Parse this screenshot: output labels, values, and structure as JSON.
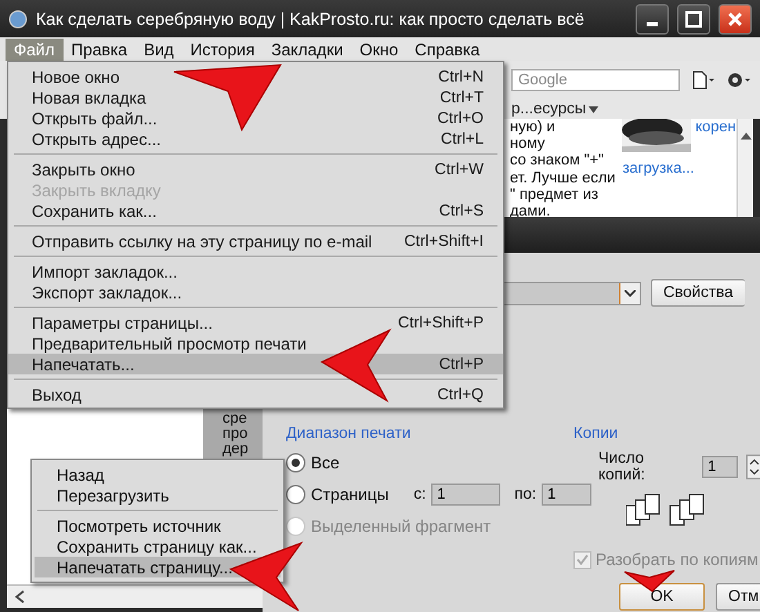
{
  "window": {
    "title": "Как сделать серебряную воду | KakProsto.ru: как просто сделать всё"
  },
  "menubar": [
    {
      "label": "Файл",
      "selected": true
    },
    {
      "label": "Правка",
      "selected": false
    },
    {
      "label": "Вид",
      "selected": false
    },
    {
      "label": "История",
      "selected": false
    },
    {
      "label": "Закладки",
      "selected": false
    },
    {
      "label": "Окно",
      "selected": false
    },
    {
      "label": "Справка",
      "selected": false
    }
  ],
  "toolbar": {
    "search": {
      "placeholder": "Google"
    },
    "bookmark": "р...есурсы"
  },
  "article": {
    "lines": [
      "ную) и",
      "ному",
      "со знаком \"+\"",
      "ет. Лучше если",
      "\" предмет из",
      "дами."
    ],
    "links": [
      "корен",
      "загрузка..."
    ]
  },
  "sidebar_fragments": [
    "сре",
    "про",
    "дер"
  ],
  "file_menu": [
    {
      "kind": "item",
      "label": "Новое окно",
      "shortcut": "Ctrl+N",
      "disabled": false,
      "highlighted": false
    },
    {
      "kind": "item",
      "label": "Новая вкладка",
      "shortcut": "Ctrl+T",
      "disabled": false,
      "highlighted": false
    },
    {
      "kind": "item",
      "label": "Открыть файл...",
      "shortcut": "Ctrl+O",
      "disabled": false,
      "highlighted": false
    },
    {
      "kind": "item",
      "label": "Открыть адрес...",
      "shortcut": "Ctrl+L",
      "disabled": false,
      "highlighted": false
    },
    {
      "kind": "separator"
    },
    {
      "kind": "item",
      "label": "Закрыть окно",
      "shortcut": "Ctrl+W",
      "disabled": false,
      "highlighted": false
    },
    {
      "kind": "item",
      "label": "Закрыть вкладку",
      "disabled": true,
      "highlighted": false
    },
    {
      "kind": "item",
      "label": "Сохранить как...",
      "shortcut": "Ctrl+S",
      "disabled": false,
      "highlighted": false
    },
    {
      "kind": "separator"
    },
    {
      "kind": "item",
      "label": "Отправить ссылку на эту страницу по e-mail",
      "shortcut": "Ctrl+Shift+I",
      "disabled": false,
      "highlighted": false
    },
    {
      "kind": "separator"
    },
    {
      "kind": "item",
      "label": "Импорт закладок...",
      "disabled": false,
      "highlighted": false
    },
    {
      "kind": "item",
      "label": "Экспорт закладок...",
      "disabled": false,
      "highlighted": false
    },
    {
      "kind": "separator"
    },
    {
      "kind": "item",
      "label": "Параметры страницы...",
      "shortcut": "Ctrl+Shift+P",
      "disabled": false,
      "highlighted": false
    },
    {
      "kind": "item",
      "label": "Предварительный просмотр печати",
      "disabled": false,
      "highlighted": false
    },
    {
      "kind": "item",
      "label": "Напечатать...",
      "shortcut": "Ctrl+P",
      "disabled": false,
      "highlighted": true
    },
    {
      "kind": "separator"
    },
    {
      "kind": "item",
      "label": "Выход",
      "shortcut": "Ctrl+Q",
      "disabled": false,
      "highlighted": false
    }
  ],
  "print_dialog": {
    "properties_button": "Свойства",
    "range": {
      "title": "Диапазон печати",
      "options": [
        {
          "kind": "all",
          "label": "Все",
          "selected": true,
          "disabled": false
        },
        {
          "kind": "pages",
          "label": "Страницы",
          "selected": false,
          "disabled": false,
          "from_label": "с:",
          "from": "1",
          "to_label": "по:",
          "to": "1"
        },
        {
          "kind": "selection",
          "label": "Выделенный фрагмент",
          "selected": false,
          "disabled": true
        }
      ]
    },
    "copies": {
      "title": "Копии",
      "label": "Число копий:",
      "value": "1",
      "collate": {
        "label": "Разобрать по копиям",
        "checked": true,
        "disabled": true
      }
    },
    "buttons": [
      "OK",
      "Отм"
    ]
  },
  "context_menu": [
    {
      "kind": "item",
      "label": "Назад",
      "highlighted": false
    },
    {
      "kind": "item",
      "label": "Перезагрузить",
      "highlighted": false
    },
    {
      "kind": "separator"
    },
    {
      "kind": "item",
      "label": "Посмотреть источник",
      "highlighted": false
    },
    {
      "kind": "item",
      "label": "Сохранить страницу как...",
      "highlighted": false
    },
    {
      "kind": "item",
      "label": "Напечатать страницу...",
      "highlighted": true
    }
  ]
}
